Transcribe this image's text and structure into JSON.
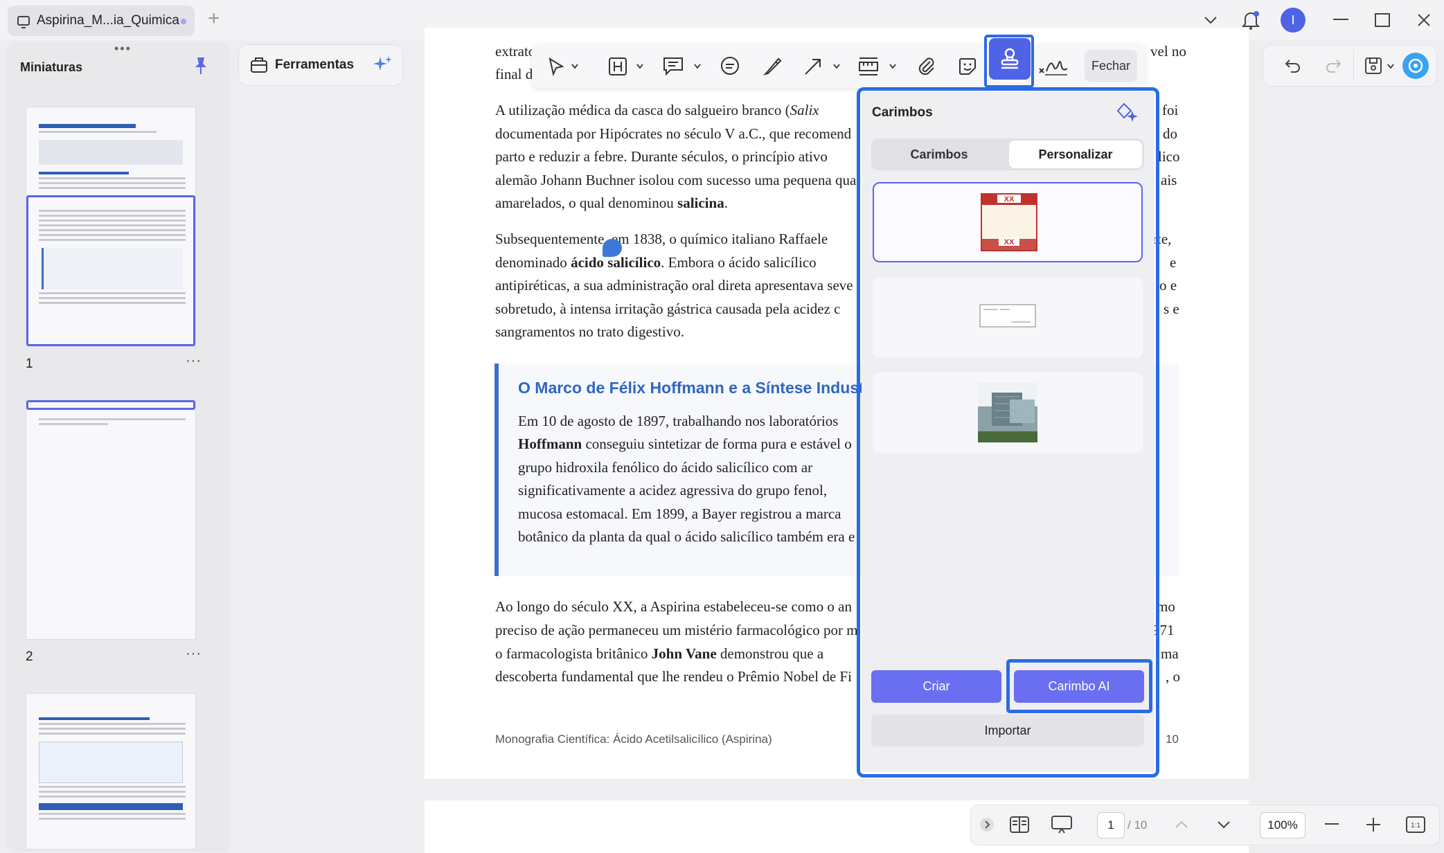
{
  "tab": {
    "title": "Aspirina_M...ia_Quimica",
    "add": "+"
  },
  "user": {
    "initial": "I"
  },
  "sidebar": {
    "title": "Miniaturas",
    "grip": "•••",
    "thumbs": [
      {
        "label": "1",
        "more": "···"
      },
      {
        "label": "2",
        "more": "···"
      }
    ]
  },
  "tools": {
    "label": "Ferramentas"
  },
  "toolbar": {
    "close_label": "Fechar"
  },
  "document": {
    "p0_a": "extrato",
    "p0_end": "vel no",
    "p0_b": "final d",
    "p1_pre": "A utilização médica da casca do salgueiro branco (",
    "p1_italic": "Salix",
    "p1_line2": "documentada por Hipócrates no século V a.C., que recomend",
    "p1_line3": "parto e reduzir a febre. Durante séculos, o princípio ativo",
    "p1_line4": "alemão Johann Buchner isolou com sucesso uma pequena qua",
    "p1_line5_pre": "amarelados, o qual denominou ",
    "p1_line5_bold": "salicina",
    "p1_line5_post": ".",
    "p1_right": [
      "foi",
      "do",
      "lico",
      "ais"
    ],
    "p2_line1": "Subsequentemente, em 1838, o químico italiano Raffaele",
    "p2_line2_pre": "denominado ",
    "p2_line2_bold": "ácido salicílico",
    "p2_line2_post": ". Embora o ácido salicílico",
    "p2_line3": "antipiréticas, a sua administração oral direta apresentava seve",
    "p2_line4": "sobretudo, à intensa irritação gástrica causada pela acidez c",
    "p2_line5": "sangramentos no trato digestivo.",
    "p2_right": [
      "rte,",
      "e",
      "o e",
      "s e"
    ],
    "callout_title": "O Marco de Félix Hoffmann e a Síntese Industr",
    "c_line1": "Em 10 de agosto de 1897, trabalhando nos laboratórios",
    "c_line2_bold": "Hoffmann",
    "c_line2_post": " conseguiu sintetizar de forma pura e estável o",
    "c_line3": "grupo hidroxila fenólico do ácido salicílico com ar",
    "c_line4": "significativamente a acidez agressiva do grupo fenol,",
    "c_line5": "mucosa estomacal. Em 1899, a Bayer registrou a marca",
    "c_line6": "botânico da planta da qual o ácido salicílico também era e",
    "p3_line1": "Ao longo do século XX, a Aspirina estabeleceu-se como o an",
    "p3_line2": "preciso de ação permaneceu um mistério farmacológico por m",
    "p3_line3_pre": "o farmacologista britânico ",
    "p3_line3_bold": "John Vane",
    "p3_line3_post": " demonstrou que a",
    "p3_line4": "descoberta fundamental que lhe rendeu o Prêmio Nobel de Fi",
    "p3_right": [
      "mo",
      "971",
      "ma",
      ", o"
    ],
    "footer_left": "Monografia Científica: Ácido Acetilsalicílico (Aspirina)",
    "footer_right": "10"
  },
  "stamps_panel": {
    "title": "Carimbos",
    "tab_a": "Carimbos",
    "tab_b": "Personalizar",
    "create": "Criar",
    "ai": "Carimbo AI",
    "import": "Importar",
    "card1_text": "XX"
  },
  "bottom": {
    "page": "1",
    "total": "/ 10",
    "zoom": "100%",
    "fit": "1:1"
  },
  "colors": {
    "accent": "#4f63e6",
    "highlight": "#2a6ce5",
    "button": "#6a6ef0",
    "callout_title": "#2f66c4"
  }
}
